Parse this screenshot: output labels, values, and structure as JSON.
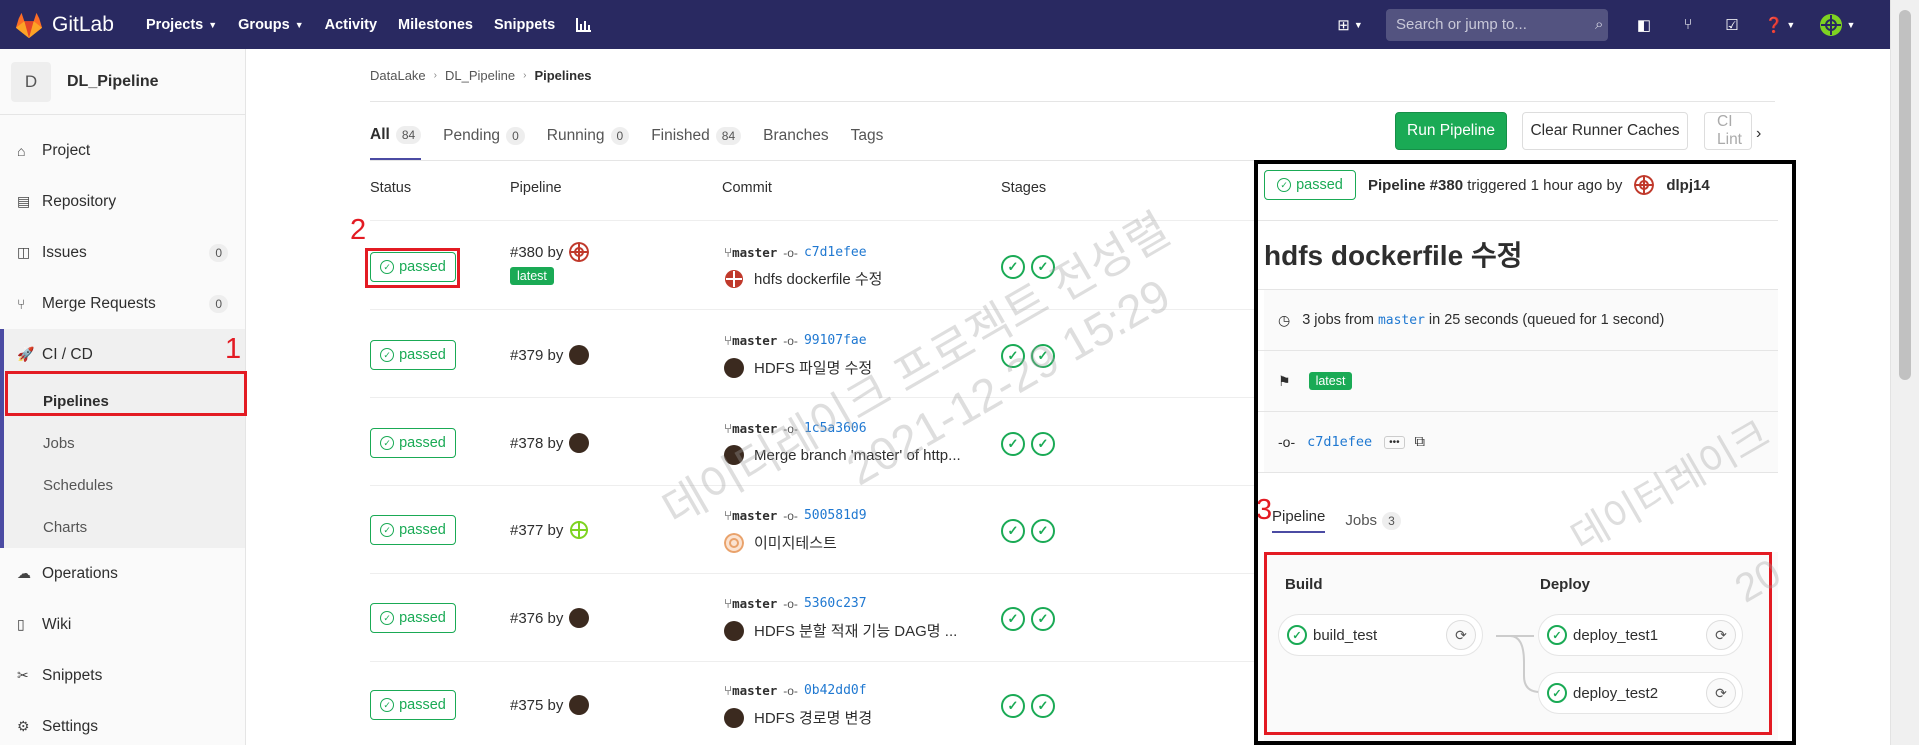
{
  "topnav": {
    "brand": "GitLab",
    "links": [
      {
        "label": "Projects",
        "dropdown": true
      },
      {
        "label": "Groups",
        "dropdown": true
      },
      {
        "label": "Activity",
        "dropdown": false
      },
      {
        "label": "Milestones",
        "dropdown": false
      },
      {
        "label": "Snippets",
        "dropdown": false
      }
    ],
    "search_placeholder": "Search or jump to..."
  },
  "sidebar": {
    "project_initial": "D",
    "project_name": "DL_Pipeline",
    "items": [
      {
        "label": "Project",
        "icon": "home-icon"
      },
      {
        "label": "Repository",
        "icon": "doc-icon"
      },
      {
        "label": "Issues",
        "icon": "issues-icon",
        "count": "0"
      },
      {
        "label": "Merge Requests",
        "icon": "merge-icon",
        "count": "0"
      }
    ],
    "cicd": {
      "label": "CI / CD",
      "sub": [
        "Pipelines",
        "Jobs",
        "Schedules",
        "Charts"
      ]
    },
    "items_after": [
      {
        "label": "Operations",
        "icon": "cloud-icon"
      },
      {
        "label": "Wiki",
        "icon": "book-icon"
      },
      {
        "label": "Snippets",
        "icon": "scissors-icon"
      },
      {
        "label": "Settings",
        "icon": "gear-icon"
      }
    ]
  },
  "annotations": [
    "1",
    "2",
    "3"
  ],
  "breadcrumb": [
    "DataLake",
    "DL_Pipeline",
    "Pipelines"
  ],
  "tabs": [
    {
      "label": "All",
      "count": "84"
    },
    {
      "label": "Pending",
      "count": "0"
    },
    {
      "label": "Running",
      "count": "0"
    },
    {
      "label": "Finished",
      "count": "84"
    },
    {
      "label": "Branches",
      "count": null
    },
    {
      "label": "Tags",
      "count": null
    }
  ],
  "buttons": {
    "run": "Run Pipeline",
    "clear": "Clear Runner Caches",
    "lint": "CI Lint"
  },
  "table": {
    "headers": [
      "Status",
      "Pipeline",
      "Commit",
      "Stages"
    ],
    "rows": [
      {
        "status": "passed",
        "id": "#380 by",
        "latest": "latest",
        "branch": "master",
        "sha": "c7d1efee",
        "message": "hdfs dockerfile 수정"
      },
      {
        "status": "passed",
        "id": "#379 by",
        "latest": null,
        "branch": "master",
        "sha": "99107fae",
        "message": "HDFS 파일명 수정"
      },
      {
        "status": "passed",
        "id": "#378 by",
        "latest": null,
        "branch": "master",
        "sha": "1c5a3606",
        "message": "Merge branch 'master' of http..."
      },
      {
        "status": "passed",
        "id": "#377 by",
        "latest": null,
        "branch": "master",
        "sha": "500581d9",
        "message": "이미지테스트"
      },
      {
        "status": "passed",
        "id": "#376 by",
        "latest": null,
        "branch": "master",
        "sha": "5360c237",
        "message": "HDFS 분할 적재 기능 DAG명 ..."
      },
      {
        "status": "passed",
        "id": "#375 by",
        "latest": null,
        "branch": "master",
        "sha": "0b42dd0f",
        "message": "HDFS 경로명 변경"
      }
    ]
  },
  "watermark": {
    "line1": "데이터레이크 프로젝트 전성렬",
    "line2": "2021-12-29 15:29"
  },
  "popup": {
    "status": "passed",
    "pipeline": "Pipeline #380",
    "triggered": "triggered 1 hour ago by",
    "user": "dlpj14",
    "title": "hdfs dockerfile 수정",
    "info_pre": "3 jobs from",
    "info_branch": "master",
    "info_post": "in 25 seconds (queued for 1 second)",
    "tag": "latest",
    "sha": "c7d1efee",
    "tabs": [
      {
        "label": "Pipeline"
      },
      {
        "label": "Jobs",
        "count": "3"
      }
    ],
    "stages": [
      {
        "name": "Build",
        "jobs": [
          "build_test"
        ]
      },
      {
        "name": "Deploy",
        "jobs": [
          "deploy_test1",
          "deploy_test2"
        ]
      }
    ],
    "watermark": "데이터레이크",
    "watermark_year": "20"
  },
  "colors": {
    "nav": "#292961",
    "passed": "#1aaa55",
    "annotation": "#e31b23",
    "link": "#1f78d1"
  }
}
